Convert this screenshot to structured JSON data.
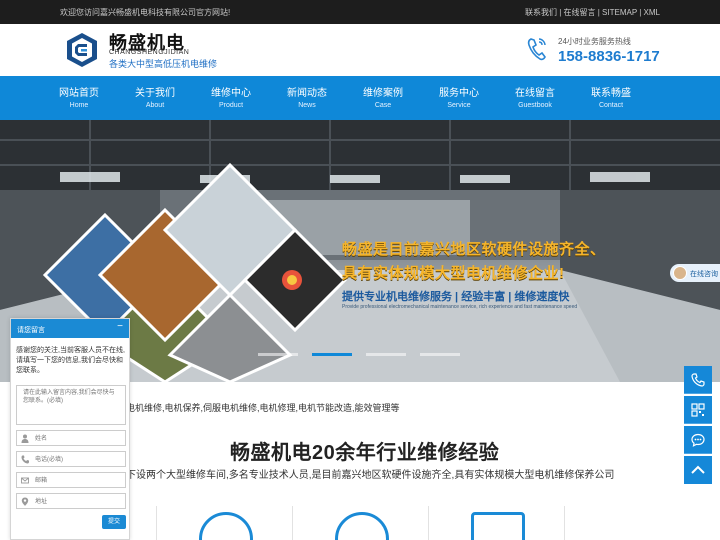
{
  "topbar": {
    "welcome": "欢迎您访问嘉兴畅盛机电科技有限公司官方网站!",
    "links": [
      "联系我们",
      "在线留言",
      "SITEMAP",
      "XML"
    ],
    "separator": " | "
  },
  "header": {
    "brand_name": "畅盛机电",
    "brand_pinyin": "CHANGSHENGJIDIAN",
    "slogan": "各类大中型高低压机电维修",
    "hotline_label": "24小时业务服务热线",
    "hotline_number": "158-8836-1717"
  },
  "nav": [
    {
      "cn": "网站首页",
      "en": "Home"
    },
    {
      "cn": "关于我们",
      "en": "About"
    },
    {
      "cn": "维修中心",
      "en": "Product"
    },
    {
      "cn": "新闻动态",
      "en": "News"
    },
    {
      "cn": "维修案例",
      "en": "Case"
    },
    {
      "cn": "服务中心",
      "en": "Service"
    },
    {
      "cn": "在线留言",
      "en": "Guestbook"
    },
    {
      "cn": "联系畅盛",
      "en": "Contact"
    }
  ],
  "banner": {
    "headline_1": "畅盛是目前嘉兴地区软硬件设施齐全、",
    "headline_2": "具有实体规模大型电机维修企业!",
    "subline": "提供专业机电维修服务 | 经验丰富 | 维修速度快",
    "subline_en": "Provide professional electromechanical maintenance service, rich experience and fast maintenance speed",
    "active_slide": 2,
    "slide_count": 4,
    "online_button": "在线咨询"
  },
  "content": {
    "services": "电机维修,电机保养,伺服电机维修,电机修理,电机节能改造,能效管理等",
    "title": "畅盛机电20余年行业维修经验",
    "description": "下设两个大型维修车间,多名专业技术人员,是目前嘉兴地区软硬件设施齐全,具有实体规模大型电机维修保养公司"
  },
  "side_tools": [
    "phone-icon",
    "qrcode-icon",
    "chat-icon",
    "back-to-top-icon"
  ],
  "chat": {
    "title": "请您留言",
    "minimize": "−",
    "message": "感谢您的关注,当前客服人员不在线,请填写一下您的信息,我们会尽快和您联系。",
    "textarea_placeholder": "请在此输入留言内容,我们会尽快与您联系。(必填)",
    "name_placeholder": "姓名",
    "phone_placeholder": "电话(必填)",
    "email_placeholder": "邮箱",
    "address_placeholder": "地址",
    "submit": "提交"
  },
  "colors": {
    "nav_blue": "#0f88d8",
    "topbar_bg": "#1d1d1d",
    "hotline": "#1e7ccf",
    "banner_gold": "#f6b52b"
  }
}
